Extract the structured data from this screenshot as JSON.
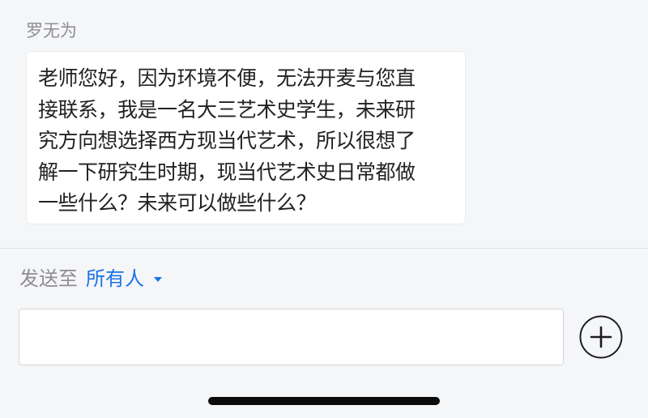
{
  "message": {
    "sender": "罗无为",
    "lines": [
      "老师您好，因为环境不便，无法开麦与您直",
      "接联系，我是一名大三艺术史学生，未来研",
      "究方向想选择西方现当代艺术，所以很想了",
      "解一下研究生时期，现当代艺术史日常都做",
      "一些什么？未来可以做些什么？"
    ]
  },
  "composer": {
    "send_to_label": "发送至",
    "recipient": "所有人",
    "input_value": "",
    "input_placeholder": ""
  },
  "icons": {
    "recipient_dropdown": "caret-down-icon",
    "add": "plus-circle-icon"
  },
  "colors": {
    "accent": "#1a73e8",
    "background": "#f5f6f7",
    "bubble": "#ffffff",
    "muted_text": "#8e8e93"
  }
}
